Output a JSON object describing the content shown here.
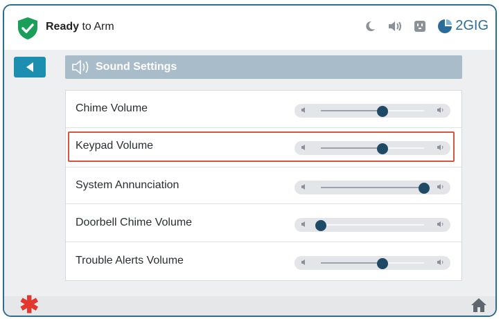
{
  "status": {
    "bold": "Ready",
    "rest": " to Arm"
  },
  "brand": {
    "name": "2GIG"
  },
  "header": {
    "title": "Sound Settings"
  },
  "settings": [
    {
      "label": "Chime Volume",
      "level": 0.6
    },
    {
      "label": "Keypad Volume",
      "level": 0.6,
      "selected": true
    },
    {
      "label": "System Annunciation",
      "level": 1.0
    },
    {
      "label": "Doorbell Chime Volume",
      "level": 0.0
    },
    {
      "label": "Trouble Alerts Volume",
      "level": 0.6
    }
  ],
  "icons": {
    "status": "shield-check-icon",
    "night": "moon-icon",
    "sound": "speaker-icon",
    "tile": "outlet-icon",
    "back": "back-arrow-icon",
    "header": "speaker-icon",
    "home": "home-icon",
    "emergency": "asterisk-icon"
  },
  "colors": {
    "accent": "#1c8fb0",
    "status_ok": "#1a9e5a",
    "alert": "#e2362f",
    "selection": "#d9533f"
  }
}
